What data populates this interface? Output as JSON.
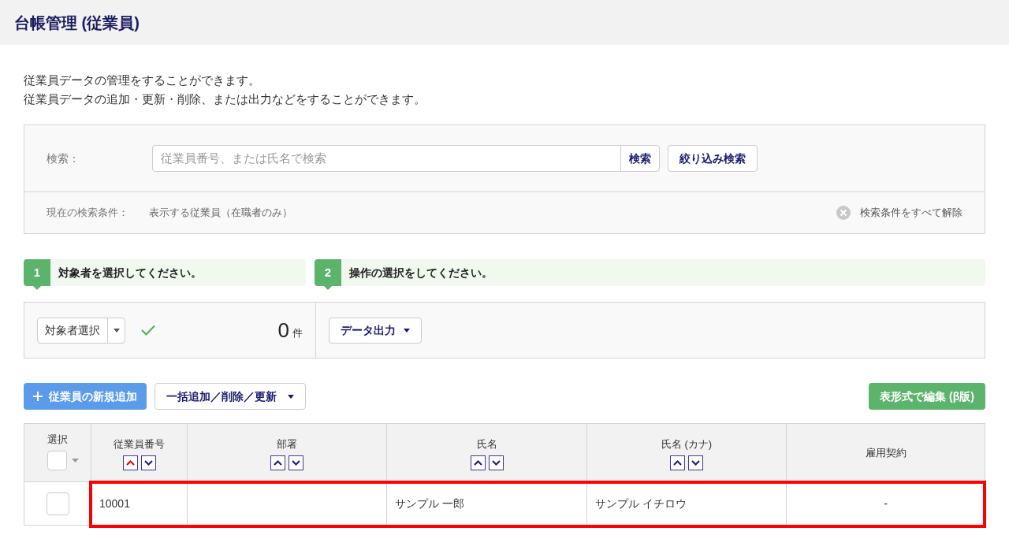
{
  "page_title": "台帳管理 (従業員)",
  "description": [
    "従業員データの管理をすることができます。",
    "従業員データの追加・更新・削除、または出力などをすることができます。"
  ],
  "search": {
    "label": "検索：",
    "placeholder": "従業員番号、または氏名で検索",
    "search_button": "検索",
    "filter_button": "絞り込み検索",
    "conditions_label": "現在の検索条件：",
    "conditions_value": "表示する従業員（在職者のみ）",
    "clear_button": "検索条件をすべて解除"
  },
  "steps": [
    {
      "number": "1",
      "text": "対象者を選択してください。"
    },
    {
      "number": "2",
      "text": "操作の選択をしてください。"
    }
  ],
  "selection": {
    "dropdown": "対象者選択",
    "confirmed": true,
    "count": "0",
    "count_unit": "件",
    "output_button": "データ出力"
  },
  "actions": {
    "add_button": "従業員の新規追加",
    "bulk_button": "一括追加／削除／更新",
    "grid_edit_button": "表形式で編集 (β版)"
  },
  "table": {
    "select_header": "選択",
    "select_all_checked": false,
    "columns": [
      {
        "kind": "sortable",
        "label": "従業員番号",
        "sorted_ascending": true
      },
      {
        "kind": "sortable",
        "label": "部署",
        "sorted_ascending": false
      },
      {
        "kind": "sortable",
        "label": "氏名",
        "sorted_ascending": false
      },
      {
        "kind": "sortable",
        "label": "氏名 (カナ)",
        "sorted_ascending": false
      },
      {
        "kind": "plain",
        "label": "雇用契約"
      }
    ],
    "rows": [
      {
        "checked": false,
        "highlighted": true,
        "cells": [
          "10001",
          "",
          "サンプル 一郎",
          "サンプル イチロウ",
          "-"
        ]
      }
    ]
  }
}
